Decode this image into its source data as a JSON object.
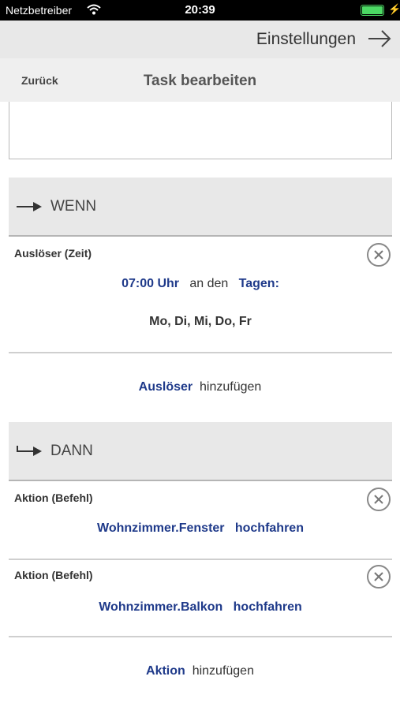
{
  "status": {
    "carrier": "Netzbetreiber",
    "time": "20:39",
    "battery_level": 1.0
  },
  "topbar": {
    "settings_label": "Einstellungen"
  },
  "nav": {
    "back_label": "Zurück",
    "title": "Task bearbeiten"
  },
  "when": {
    "header": "WENN",
    "trigger": {
      "title": "Auslöser (Zeit)",
      "time": "07:00 Uhr",
      "middle": "an den",
      "days_label": "Tagen:",
      "days": "Mo, Di, Mi, Do, Fr"
    },
    "add": {
      "keyword": "Auslöser",
      "rest": "hinzufügen"
    }
  },
  "then": {
    "header": "DANN",
    "actions": [
      {
        "title": "Aktion (Befehl)",
        "target": "Wohnzimmer.Fenster",
        "command": "hochfahren"
      },
      {
        "title": "Aktion (Befehl)",
        "target": "Wohnzimmer.Balkon",
        "command": "hochfahren"
      }
    ],
    "add": {
      "keyword": "Aktion",
      "rest": "hinzufügen"
    }
  }
}
